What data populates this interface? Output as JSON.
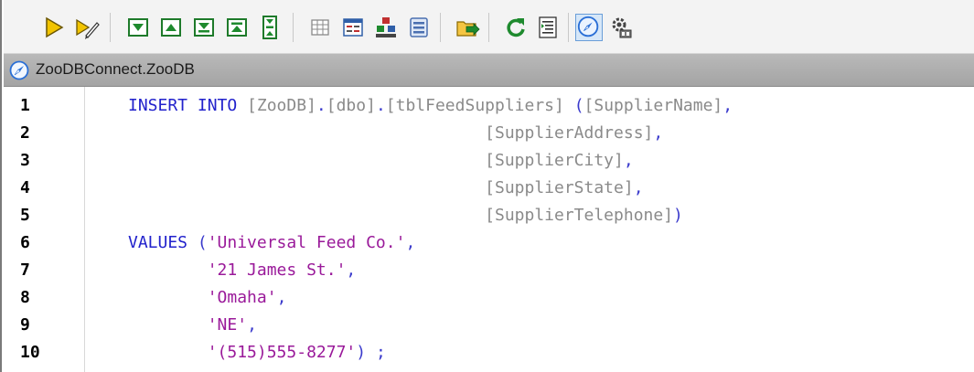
{
  "toolbar": {
    "buttons": [
      {
        "name": "execute-icon",
        "color": "#e3b700"
      },
      {
        "name": "execute-for-data-editing-icon",
        "color": "#e3b700"
      },
      {
        "name": "next-result-icon",
        "color": "#1e8a2e"
      },
      {
        "name": "previous-result-icon",
        "color": "#1e8a2e"
      },
      {
        "name": "last-result-icon",
        "color": "#1e8a2e"
      },
      {
        "name": "first-result-icon",
        "color": "#1e8a2e"
      },
      {
        "name": "expand-results-icon",
        "color": "#1e8a2e"
      },
      {
        "name": "grid-view-icon",
        "color": "#7a7a7a"
      },
      {
        "name": "text-view-icon",
        "color": "#2f5fa8"
      },
      {
        "name": "stacked-view-icon",
        "color": "#c03030"
      },
      {
        "name": "properties-icon",
        "color": "#4a6fb0"
      },
      {
        "name": "export-icon",
        "color": "#e3a300"
      },
      {
        "name": "refresh-icon",
        "color": "#1e8a2e"
      },
      {
        "name": "format-sql-icon",
        "color": "#1e8a2e"
      },
      {
        "name": "connect-icon",
        "color": "#2a6fd6"
      },
      {
        "name": "settings-icon",
        "color": "#555555"
      }
    ]
  },
  "connection": {
    "label": "ZooDBConnect.ZooDB"
  },
  "editor": {
    "lines": [
      {
        "num": "1",
        "tokens": [
          {
            "t": "INSERT INTO ",
            "c": "kw"
          },
          {
            "t": "[ZooDB]",
            "c": "id"
          },
          {
            "t": ".",
            "c": "pu"
          },
          {
            "t": "[dbo]",
            "c": "id"
          },
          {
            "t": ".",
            "c": "pu"
          },
          {
            "t": "[tblFeedSuppliers]",
            "c": "id"
          },
          {
            "t": " (",
            "c": "pu"
          },
          {
            "t": "[SupplierName]",
            "c": "id"
          },
          {
            "t": ",",
            "c": "pu"
          }
        ]
      },
      {
        "num": "2",
        "tokens": [
          {
            "t": "                                    ",
            "c": "pu"
          },
          {
            "t": "[SupplierAddress]",
            "c": "id"
          },
          {
            "t": ",",
            "c": "pu"
          }
        ]
      },
      {
        "num": "3",
        "tokens": [
          {
            "t": "                                    ",
            "c": "pu"
          },
          {
            "t": "[SupplierCity]",
            "c": "id"
          },
          {
            "t": ",",
            "c": "pu"
          }
        ]
      },
      {
        "num": "4",
        "tokens": [
          {
            "t": "                                    ",
            "c": "pu"
          },
          {
            "t": "[SupplierState]",
            "c": "id"
          },
          {
            "t": ",",
            "c": "pu"
          }
        ]
      },
      {
        "num": "5",
        "tokens": [
          {
            "t": "                                    ",
            "c": "pu"
          },
          {
            "t": "[SupplierTelephone]",
            "c": "id"
          },
          {
            "t": ")",
            "c": "pu"
          }
        ]
      },
      {
        "num": "6",
        "tokens": [
          {
            "t": "VALUES ",
            "c": "kw"
          },
          {
            "t": "(",
            "c": "pu"
          },
          {
            "t": "'Universal Feed Co.'",
            "c": "st"
          },
          {
            "t": ",",
            "c": "pu"
          }
        ]
      },
      {
        "num": "7",
        "tokens": [
          {
            "t": "        ",
            "c": "pu"
          },
          {
            "t": "'21 James St.'",
            "c": "st"
          },
          {
            "t": ",",
            "c": "pu"
          }
        ]
      },
      {
        "num": "8",
        "tokens": [
          {
            "t": "        ",
            "c": "pu"
          },
          {
            "t": "'Omaha'",
            "c": "st"
          },
          {
            "t": ",",
            "c": "pu"
          }
        ]
      },
      {
        "num": "9",
        "tokens": [
          {
            "t": "        ",
            "c": "pu"
          },
          {
            "t": "'NE'",
            "c": "st"
          },
          {
            "t": ",",
            "c": "pu"
          }
        ]
      },
      {
        "num": "10",
        "tokens": [
          {
            "t": "        ",
            "c": "pu"
          },
          {
            "t": "'(515)555-8277'",
            "c": "st"
          },
          {
            "t": ") ;",
            "c": "pu"
          }
        ]
      }
    ]
  }
}
